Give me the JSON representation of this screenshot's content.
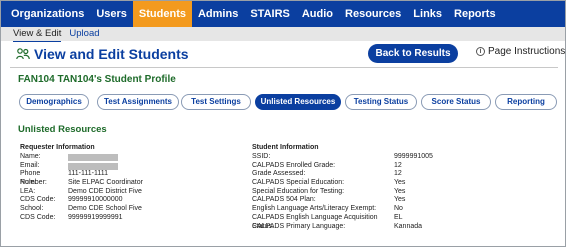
{
  "nav": {
    "items": [
      {
        "label": "Organizations",
        "active": false
      },
      {
        "label": "Users",
        "active": false
      },
      {
        "label": "Students",
        "active": true
      },
      {
        "label": "Admins",
        "active": false
      },
      {
        "label": "STAIRS",
        "active": false
      },
      {
        "label": "Audio",
        "active": false
      },
      {
        "label": "Resources",
        "active": false
      },
      {
        "label": "Links",
        "active": false
      },
      {
        "label": "Reports",
        "active": false
      }
    ],
    "active_color": "#f39a1e",
    "bar_color": "#0b3fa0"
  },
  "subnav": {
    "items": [
      {
        "label": "View & Edit",
        "active": true
      },
      {
        "label": "Upload",
        "active": false
      }
    ]
  },
  "header": {
    "icon": "people-icon",
    "title": "View and Edit Students",
    "back_button": "Back to Results",
    "instructions_link": "Page Instructions"
  },
  "profile": {
    "title": "FAN104 TAN104's Student Profile"
  },
  "tabs": [
    {
      "label": "Demographics",
      "active": false
    },
    {
      "label": "Test Assignments",
      "active": false
    },
    {
      "label": "Test Settings",
      "active": false
    },
    {
      "label": "Unlisted Resources",
      "active": true
    },
    {
      "label": "Testing Status",
      "active": false
    },
    {
      "label": "Score Status",
      "active": false
    },
    {
      "label": "Reporting",
      "active": false
    }
  ],
  "section": {
    "title": "Unlisted Resources"
  },
  "requester": {
    "heading": "Requester Information",
    "rows": [
      {
        "label": "Name:",
        "value": "",
        "redacted": true
      },
      {
        "label": "Email:",
        "value": "",
        "redacted": true
      },
      {
        "label": "Phone Number:",
        "value": "111-111-1111"
      },
      {
        "label": "Role:",
        "value": "Site ELPAC Coordinator"
      },
      {
        "label": "LEA:",
        "value": "Demo CDE District Five"
      },
      {
        "label": "CDS Code:",
        "value": "99999910000000"
      },
      {
        "label": "School:",
        "value": "Demo CDE School Five"
      },
      {
        "label": "CDS Code:",
        "value": "99999919999991"
      }
    ]
  },
  "student": {
    "heading": "Student Information",
    "rows": [
      {
        "label": "SSID:",
        "value": "9999991005"
      },
      {
        "label": "CALPADS Enrolled Grade:",
        "value": "12"
      },
      {
        "label": "Grade Assessed:",
        "value": "12"
      },
      {
        "label": "CALPADS Special Education:",
        "value": "Yes"
      },
      {
        "label": "Special Education for Testing:",
        "value": "Yes"
      },
      {
        "label": "CALPADS 504 Plan:",
        "value": "Yes"
      },
      {
        "label": "English Language Arts/Literacy Exempt:",
        "value": "No"
      },
      {
        "label": "CALPADS English Language Acquisition Status:",
        "value": "EL"
      },
      {
        "label": "CALPADS Primary Language:",
        "value": "Kannada"
      }
    ]
  }
}
